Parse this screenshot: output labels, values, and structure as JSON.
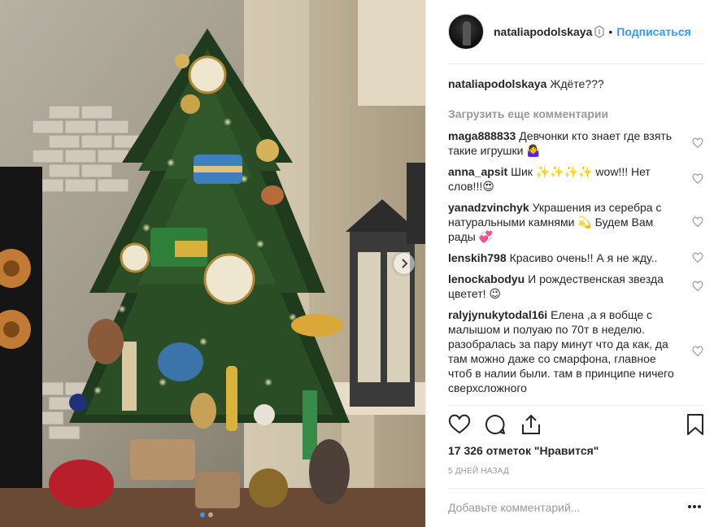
{
  "post": {
    "author": {
      "username": "nataliapodolskaya",
      "separator": "•",
      "follow_label": "Подписаться"
    },
    "caption": {
      "username": "nataliapodolskaya",
      "text": "Ждёте???"
    },
    "load_more_label": "Загрузить еще комментарии",
    "comments": [
      {
        "username": "maga888833",
        "text": "Девчонки кто знает где взять такие игрушки 🤷‍♀️"
      },
      {
        "username": "anna_apsit",
        "text": "Шик ✨✨✨✨ wow!!! Нет слов!!!😍"
      },
      {
        "username": "yanadzvinchyk",
        "text": "Украшения из серебра с натуральными камнями 💫 Будем Вам рады 💞"
      },
      {
        "username": "lenskih798",
        "text": "Красиво очень!! А я не жду.."
      },
      {
        "username": "lenockabodyu",
        "text": "И рождественская звезда цветет! 😉"
      },
      {
        "username": "ralyjynukytodal16i",
        "text": "Елена ,а я вобще с малышом и полуаю по 70т в неделю. разобралась за пару минут что да как, да там можно даже со смарфона, главное чтоб в налии были. там в принципе ничего сверхсложного"
      }
    ],
    "likes_text": "17 326 отметок \"Нравится\"",
    "date_text": "5 ДНЕЙ НАЗАД",
    "add_comment_placeholder": "Добавьте комментарий...",
    "colors": {
      "link": "#3897f0",
      "muted": "#999999",
      "text": "#262626",
      "divider": "#efefef"
    },
    "icons": {
      "like": "heart-icon",
      "comment": "comment-bubble-icon",
      "share": "share-icon",
      "save": "bookmark-icon",
      "more": "more-dots-icon",
      "next": "chevron-right-icon"
    },
    "carousel": {
      "slides": 2,
      "active": 1
    }
  }
}
